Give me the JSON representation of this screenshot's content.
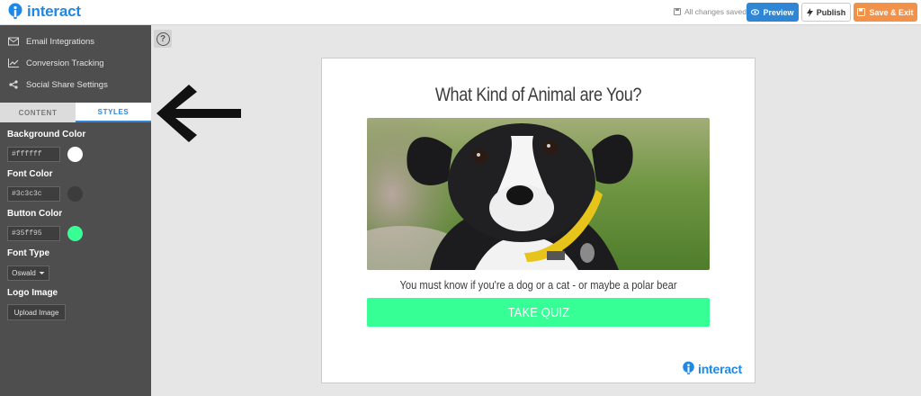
{
  "app": {
    "brand": "interact",
    "brand_color": "#1e88e5"
  },
  "header": {
    "save_status": "All changes saved",
    "preview_label": "Preview",
    "publish_label": "Publish",
    "save_exit_label": "Save & Exit"
  },
  "sidebar": {
    "menu": [
      {
        "label": "Email Integrations",
        "icon": "envelope-icon"
      },
      {
        "label": "Conversion Tracking",
        "icon": "line-chart-icon"
      },
      {
        "label": "Social Share Settings",
        "icon": "share-icon"
      }
    ],
    "tabs": {
      "content": "CONTENT",
      "styles": "STYLES",
      "active": "styles"
    },
    "styles": {
      "background_color_label": "Background Color",
      "background_color_value": "#ffffff",
      "font_color_label": "Font Color",
      "font_color_value": "#3c3c3c",
      "button_color_label": "Button Color",
      "button_color_value": "#35ff95",
      "font_type_label": "Font Type",
      "font_type_value": "Oswald",
      "logo_image_label": "Logo Image",
      "upload_label": "Upload Image"
    }
  },
  "canvas": {
    "help_icon": "question-circle-icon",
    "annotation_icon": "left-arrow-icon"
  },
  "quiz_card": {
    "title": "What Kind of Animal are You?",
    "image_alt": "puppy-photo",
    "subtitle": "You must know if you're a dog or a cat - or maybe a polar bear",
    "cta_label": "TAKE QUIZ",
    "footer_brand": "interact"
  }
}
